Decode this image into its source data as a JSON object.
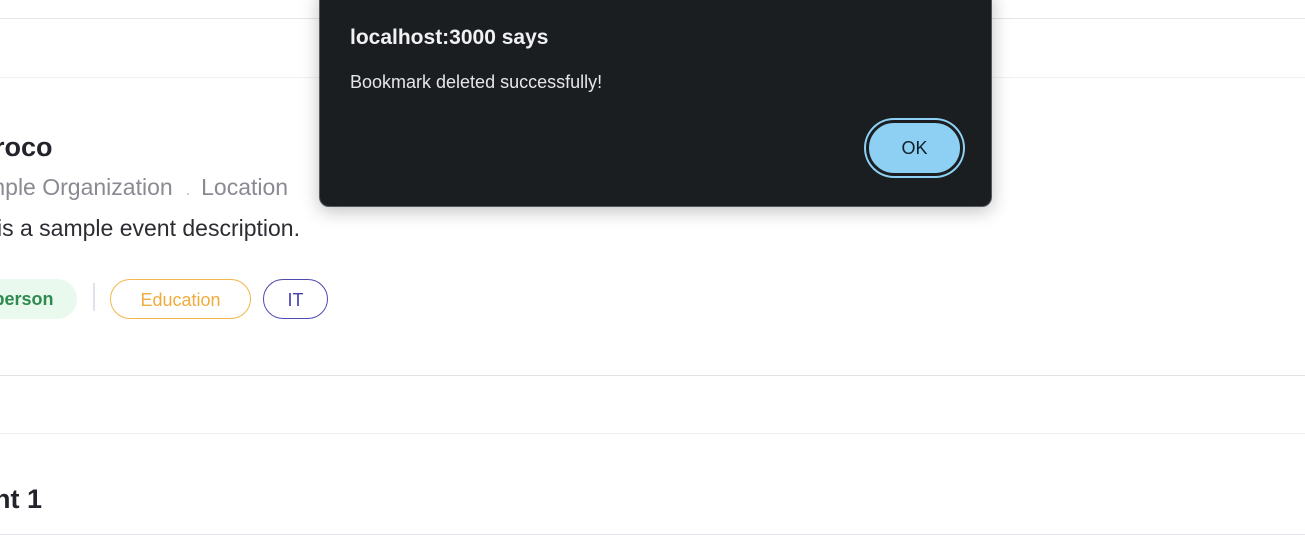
{
  "events": [
    {
      "title": "roco",
      "organization": "mple Organization",
      "separator": ".",
      "location": "Location",
      "description": "is a sample event description.",
      "tags": {
        "mode": "person",
        "category": "Education",
        "field": "IT"
      }
    },
    {
      "title": "nt 1"
    }
  ],
  "alert": {
    "title": "localhost:3000 says",
    "message": "Bookmark deleted successfully!",
    "ok_label": "OK"
  },
  "colors": {
    "dialog_background": "#1b1e21",
    "ok_button": "#8dd0f3",
    "tag_mode_bg": "#e9f9ee",
    "tag_mode_text": "#2f8a50",
    "tag_education": "#f0ad3c",
    "tag_it": "#4543a9"
  }
}
